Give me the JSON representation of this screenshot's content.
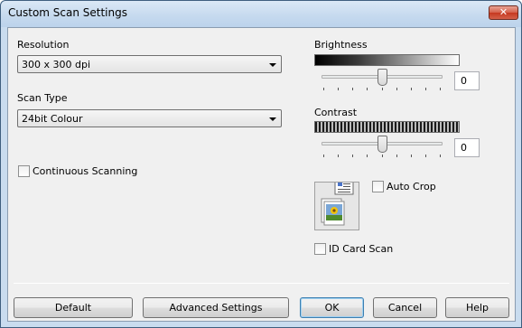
{
  "window": {
    "title": "Custom Scan Settings",
    "close_label": "✕"
  },
  "resolution": {
    "label": "Resolution",
    "value": "300 x 300 dpi"
  },
  "scan_type": {
    "label": "Scan Type",
    "value": "24bit Colour"
  },
  "continuous": {
    "label": "Continuous Scanning",
    "checked": false
  },
  "brightness": {
    "label": "Brightness",
    "value": "0",
    "level": 0.5
  },
  "contrast": {
    "label": "Contrast",
    "value": "0",
    "level": 0.5
  },
  "auto_crop": {
    "label": "Auto Crop",
    "checked": false
  },
  "id_card": {
    "label": "ID Card Scan",
    "checked": false
  },
  "buttons": {
    "default": "Default",
    "advanced": "Advanced Settings",
    "ok": "OK",
    "cancel": "Cancel",
    "help": "Help"
  },
  "icons": {
    "preview": "document-photo-preview-icon",
    "close": "close-icon",
    "dropdown": "chevron-down-icon"
  }
}
